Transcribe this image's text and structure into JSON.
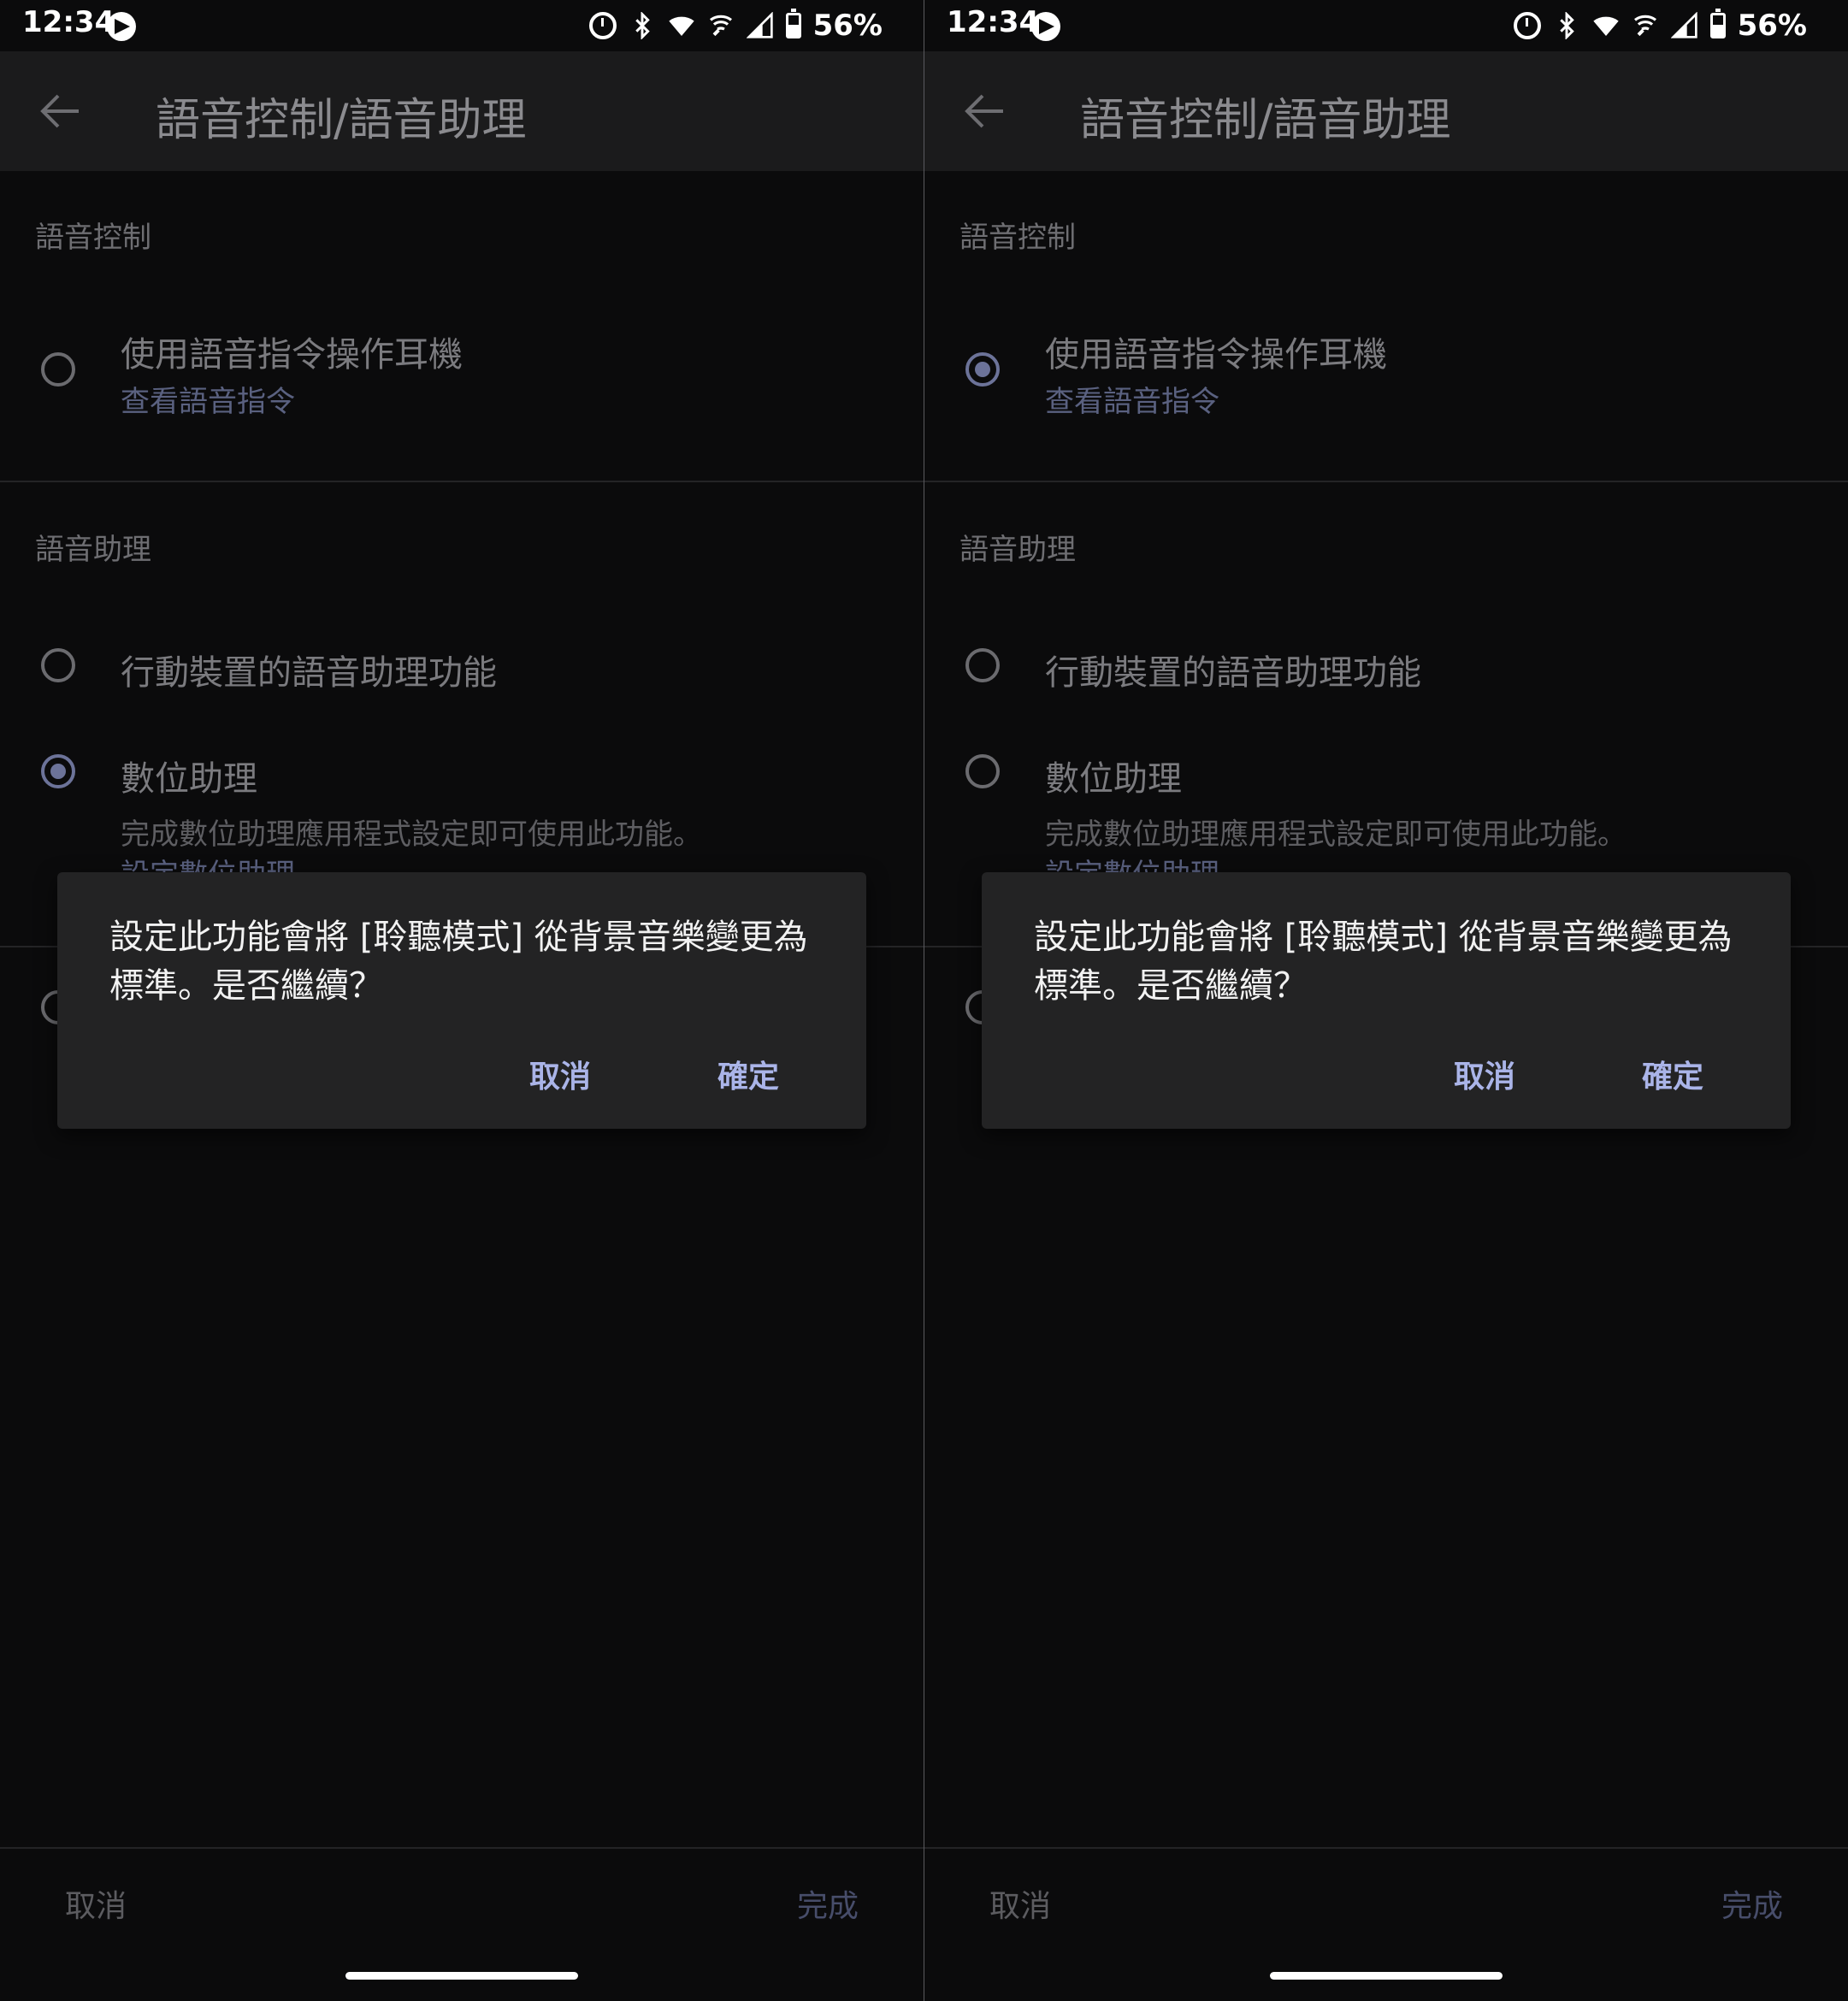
{
  "screens": [
    {
      "status": {
        "time": "12:34",
        "battery": "56%"
      },
      "title": "語音控制/語音助理",
      "voice_control": {
        "header": "語音控制",
        "option_title": "使用語音指令操作耳機",
        "option_link": "查看語音指令",
        "selected": false
      },
      "voice_assistant": {
        "header": "語音助理",
        "option1_title": "行動裝置的語音助理功能",
        "option2_title": "數位助理",
        "option2_desc": "完成數位助理應用程式設定即可使用此功能。",
        "option2_link_partial": "設定數位助理",
        "selected": "option2"
      },
      "dialog": {
        "message": "設定此功能會將 [聆聽模式] 從背景音樂變更為標準。是否繼續？",
        "cancel": "取消",
        "ok": "確定"
      },
      "bottom": {
        "cancel": "取消",
        "done": "完成"
      }
    },
    {
      "status": {
        "time": "12:34",
        "battery": "56%"
      },
      "title": "語音控制/語音助理",
      "voice_control": {
        "header": "語音控制",
        "option_title": "使用語音指令操作耳機",
        "option_link": "查看語音指令",
        "selected": true
      },
      "voice_assistant": {
        "header": "語音助理",
        "option1_title": "行動裝置的語音助理功能",
        "option2_title": "數位助理",
        "option2_desc": "完成數位助理應用程式設定即可使用此功能。",
        "option2_link_partial": "設定數位助理",
        "selected": "none"
      },
      "dialog": {
        "message": "設定此功能會將 [聆聽模式] 從背景音樂變更為標準。是否繼續？",
        "cancel": "取消",
        "ok": "確定"
      },
      "bottom": {
        "cancel": "取消",
        "done": "完成"
      }
    }
  ],
  "colors": {
    "accent": "#aab4e8",
    "radio_checked": "#6c7399",
    "background": "#0b0b0c",
    "dialog": "#232324"
  }
}
